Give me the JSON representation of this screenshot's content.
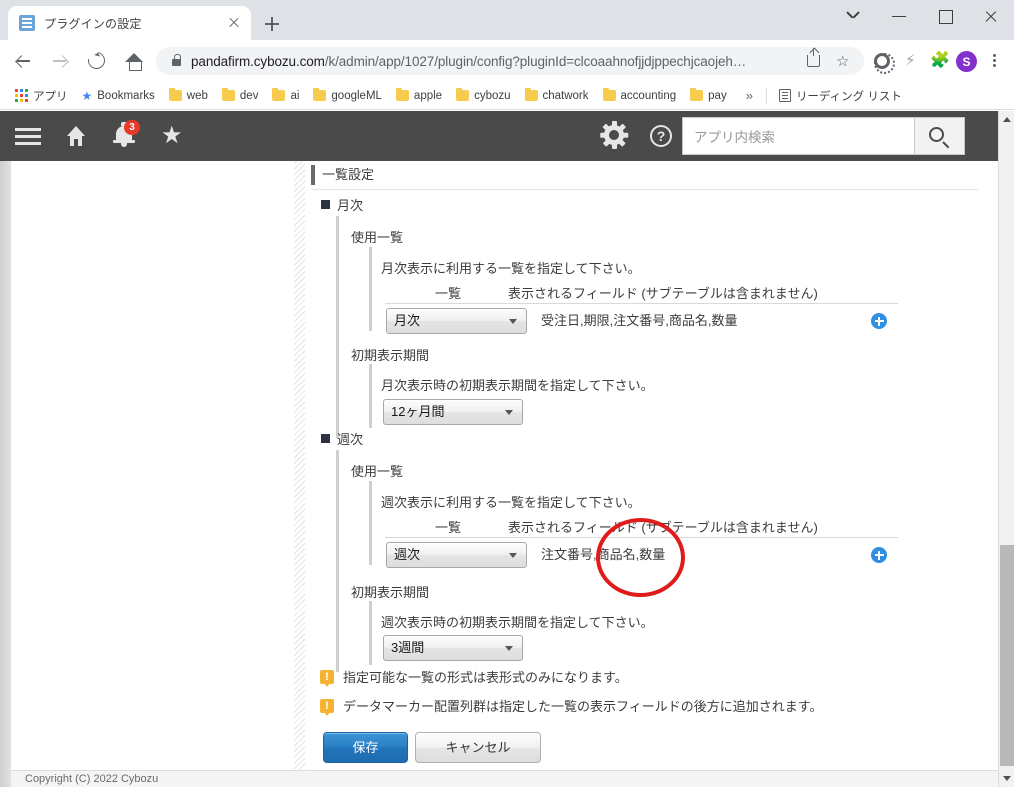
{
  "browser": {
    "tab": {
      "title": "プラグインの設定",
      "favicon": "document-icon",
      "close": "close-icon"
    },
    "new_tab_label": "+",
    "window_controls": [
      "chevron-down-icon",
      "minimize-icon",
      "maximize-icon",
      "close-icon"
    ],
    "omnibox": {
      "lock": "lock-icon",
      "url_main": "pandafirm.cybozu.com",
      "url_rest": "/k/admin/app/1027/plugin/config?pluginId=clcoaahnofjjdjppechjcaojeh…",
      "share_icon": "share-icon",
      "bookmark_icon": "star-icon"
    },
    "toolbar_icons": [
      "gear-icon",
      "bolt-icon",
      "puzzle-extension-icon"
    ],
    "profile_initial": "S",
    "menu_icon": "kebab-menu-icon",
    "bookmarks": [
      {
        "label": "アプリ",
        "icon": "apps-grid-icon"
      },
      {
        "label": "Bookmarks",
        "icon": "star-icon"
      },
      {
        "label": "web",
        "icon": "folder-icon"
      },
      {
        "label": "dev",
        "icon": "folder-icon"
      },
      {
        "label": "ai",
        "icon": "folder-icon"
      },
      {
        "label": "googleML",
        "icon": "folder-icon"
      },
      {
        "label": "apple",
        "icon": "folder-icon"
      },
      {
        "label": "cybozu",
        "icon": "folder-icon"
      },
      {
        "label": "chatwork",
        "icon": "folder-icon"
      },
      {
        "label": "accounting",
        "icon": "folder-icon"
      },
      {
        "label": "pay",
        "icon": "folder-icon"
      }
    ],
    "bookmarks_overflow": "»",
    "reading_list": {
      "label": "リーディング リスト",
      "icon": "reading-list-icon"
    }
  },
  "kintone_header": {
    "menu_icon": "hamburger-menu-icon",
    "home_icon": "home-icon",
    "notification_icon": "bell-icon",
    "notification_count": "3",
    "favorite_icon": "star-icon",
    "settings_icon": "gear-icon",
    "help_icon": "help-icon",
    "help_glyph": "?",
    "search_placeholder": "アプリ内検索",
    "search_value": "",
    "search_button_icon": "search-icon"
  },
  "settings": {
    "section_title": "一覧設定",
    "monthly": {
      "group_label": "月次",
      "use_list": {
        "label": "使用一覧",
        "description": "月次表示に利用する一覧を指定して下さい。",
        "col_list": "一覧",
        "col_fields": "表示されるフィールド (サブテーブルは含まれません)",
        "select_value": "月次",
        "fields_value": "受注日,期限,注文番号,商品名,数量",
        "add_icon": "plus-circle-icon"
      },
      "initial_period": {
        "label": "初期表示期間",
        "description": "月次表示時の初期表示期間を指定して下さい。",
        "select_value": "12ヶ月間"
      }
    },
    "weekly": {
      "group_label": "週次",
      "use_list": {
        "label": "使用一覧",
        "description": "週次表示に利用する一覧を指定して下さい。",
        "col_list": "一覧",
        "col_fields": "表示されるフィールド (サブテーブルは含まれません)",
        "select_value": "週次",
        "fields_value": "注文番号,商品名,数量",
        "add_icon": "plus-circle-icon"
      },
      "initial_period": {
        "label": "初期表示期間",
        "description": "週次表示時の初期表示期間を指定して下さい。",
        "select_value": "3週間"
      }
    },
    "notes": [
      {
        "icon": "warning-icon",
        "glyph": "!",
        "text": "指定可能な一覧の形式は表形式のみになります。"
      },
      {
        "icon": "warning-icon",
        "glyph": "!",
        "text": "データマーカー配置列群は指定した一覧の表示フィールドの後方に追加されます。"
      }
    ],
    "save_label": "保存",
    "cancel_label": "キャンセル",
    "footer": "Copyright (C) 2022 Cybozu"
  },
  "annotation": {
    "shape": "red-ellipse-highlight",
    "color": "#e01b1b"
  },
  "scrollbar": {
    "up_icon": "scroll-up-arrow-icon",
    "down_icon": "scroll-down-arrow-icon"
  }
}
